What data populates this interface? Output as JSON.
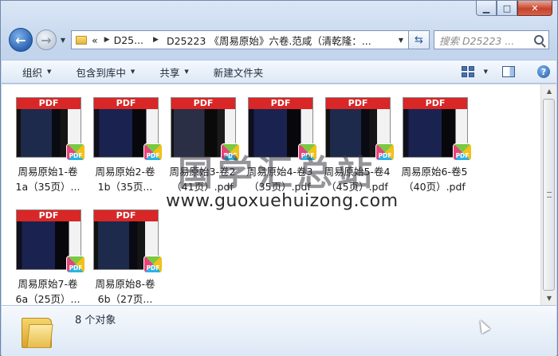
{
  "address": {
    "overflow": "«",
    "seg1": "D25...",
    "seg2": "D25223 《周易原始》六卷.范咸（清乾隆：..."
  },
  "search": {
    "placeholder": "搜索 D25223 ..."
  },
  "toolbar": {
    "organize": "组织",
    "include_library": "包含到库中",
    "share": "共享",
    "new_folder": "新建文件夹"
  },
  "files": [
    {
      "line1": "周易原始1-卷",
      "line2": "1a（35页）...",
      "badge": "PDF"
    },
    {
      "line1": "周易原始2-卷",
      "line2": "1b（35页...",
      "badge": "PDF"
    },
    {
      "line1": "周易原始3-卷2",
      "line2": "（41页）.pdf",
      "badge": "PDF"
    },
    {
      "line1": "周易原始4-卷3",
      "line2": "（35页）.pdf",
      "badge": "PDF"
    },
    {
      "line1": "周易原始5-卷4",
      "line2": "（45页）.pdf",
      "badge": "PDF"
    },
    {
      "line1": "周易原始6-卷5",
      "line2": "（40页）.pdf",
      "badge": "PDF"
    },
    {
      "line1": "周易原始7-卷",
      "line2": "6a（25页）...",
      "badge": "PDF"
    },
    {
      "line1": "周易原始8-卷",
      "line2": "6b（27页...",
      "badge": "PDF"
    }
  ],
  "thumb_label": "PDF",
  "watermark": {
    "chinese": "国学汇总站",
    "url": "www.guoxuehuizong.com"
  },
  "status": {
    "count": "8 个对象"
  }
}
